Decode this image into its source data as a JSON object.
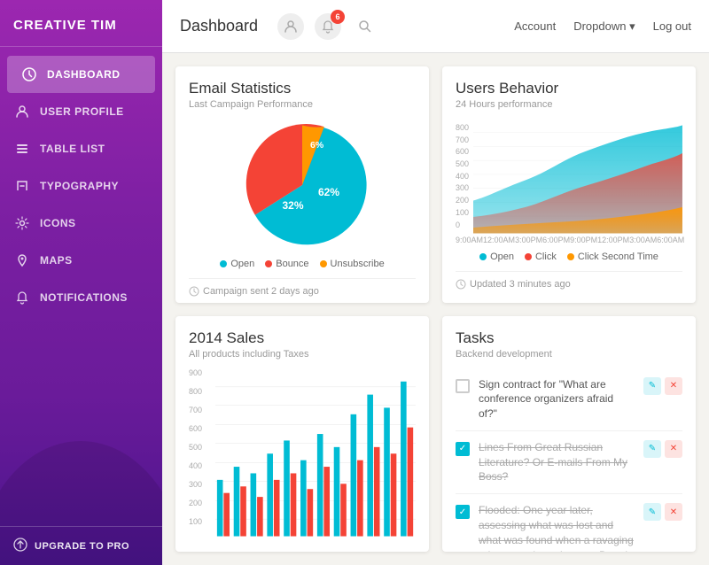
{
  "sidebar": {
    "logo": "CREATIVE TIM",
    "nav": [
      {
        "id": "dashboard",
        "label": "Dashboard",
        "icon": "clock",
        "active": true
      },
      {
        "id": "user-profile",
        "label": "User Profile",
        "icon": "user"
      },
      {
        "id": "table-list",
        "label": "Table List",
        "icon": "list"
      },
      {
        "id": "typography",
        "label": "Typography",
        "icon": "text"
      },
      {
        "id": "icons",
        "label": "Icons",
        "icon": "gear"
      },
      {
        "id": "maps",
        "label": "Maps",
        "icon": "map"
      },
      {
        "id": "notifications",
        "label": "Notifications",
        "icon": "bell"
      }
    ],
    "upgrade_label": "Upgrade to Pro"
  },
  "topbar": {
    "title": "Dashboard",
    "notification_count": "6",
    "links": {
      "account": "Account",
      "dropdown": "Dropdown",
      "logout": "Log out"
    }
  },
  "email_card": {
    "title": "Email Statistics",
    "subtitle": "Last Campaign Performance",
    "legend": [
      {
        "label": "Open",
        "color": "#00bcd4"
      },
      {
        "label": "Bounce",
        "color": "#f44336"
      },
      {
        "label": "Unsubscribe",
        "color": "#ff9800"
      }
    ],
    "footer": "Campaign sent 2 days ago",
    "slices": [
      {
        "value": 62,
        "color": "#00bcd4",
        "label": "62%"
      },
      {
        "value": 32,
        "color": "#f44336",
        "label": "32%"
      },
      {
        "value": 6,
        "color": "#ff9800",
        "label": "6%"
      }
    ]
  },
  "behavior_card": {
    "title": "Users Behavior",
    "subtitle": "24 Hours performance",
    "legend": [
      {
        "label": "Open",
        "color": "#00bcd4"
      },
      {
        "label": "Click",
        "color": "#f44336"
      },
      {
        "label": "Click Second Time",
        "color": "#ff9800"
      }
    ],
    "footer": "Updated 3 minutes ago",
    "y_labels": [
      "800",
      "700",
      "600",
      "500",
      "400",
      "300",
      "200",
      "100",
      "0"
    ],
    "x_labels": [
      "9:00AM",
      "12:00AM",
      "3:00PM",
      "6:00PM",
      "9:00PM",
      "12:00PM",
      "3:00AM",
      "6:00AM"
    ]
  },
  "sales_card": {
    "title": "2014 Sales",
    "subtitle": "All products including Taxes",
    "y_labels": [
      "900",
      "800",
      "700",
      "600",
      "500",
      "400",
      "300",
      "200",
      "100"
    ],
    "bar_colors": [
      "#00bcd4",
      "#f44336"
    ]
  },
  "tasks_card": {
    "title": "Tasks",
    "subtitle": "Backend development",
    "items": [
      {
        "id": 1,
        "checked": false,
        "text": "Sign contract for \"What are conference organizers afraid of?\""
      },
      {
        "id": 2,
        "checked": true,
        "text": "Lines From Great Russian Literature? Or E-mails From My Boss?"
      },
      {
        "id": 3,
        "checked": true,
        "text": "Flooded: One year later, assessing what was lost and what was found when a ravaging rain swept through metro Detroit"
      }
    ]
  }
}
